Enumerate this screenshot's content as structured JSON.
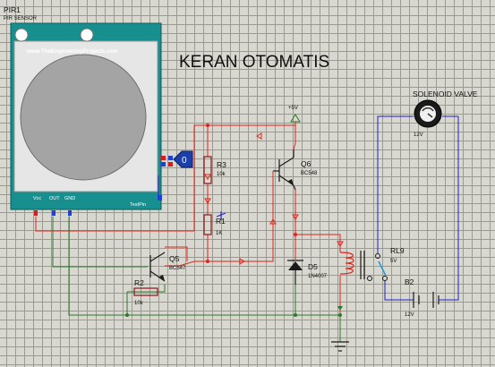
{
  "title": "KERAN OTOMATIS",
  "pir": {
    "ref": "PIR1",
    "type": "PIR SENSOR",
    "url": "www.TheEngineeringProjects.com",
    "pins": [
      "Vcc",
      "OUT",
      "GND"
    ],
    "testpin": "TestPin",
    "probe_value": "0"
  },
  "r3": {
    "ref": "R3",
    "value": "10k"
  },
  "r1": {
    "ref": "R1",
    "value": "1K"
  },
  "r2": {
    "ref": "R2",
    "value": "10k"
  },
  "q5": {
    "ref": "Q5",
    "type": "BC547"
  },
  "q6": {
    "ref": "Q6",
    "type": "BC548"
  },
  "d5": {
    "ref": "D5",
    "type": "1N4007"
  },
  "supply": {
    "label": "+5V"
  },
  "relay": {
    "ref": "RL9",
    "value": "5V"
  },
  "battery": {
    "ref": "B2",
    "value": "12V"
  },
  "valve": {
    "name": "SOLENOID VALVE",
    "value": "12V"
  },
  "colors": {
    "wire_power": "#e0241c",
    "wire_ground": "#2a7a2a",
    "wire_load": "#2020c8",
    "sensor_body": "#1a9a9a",
    "component": "#8a1414"
  }
}
